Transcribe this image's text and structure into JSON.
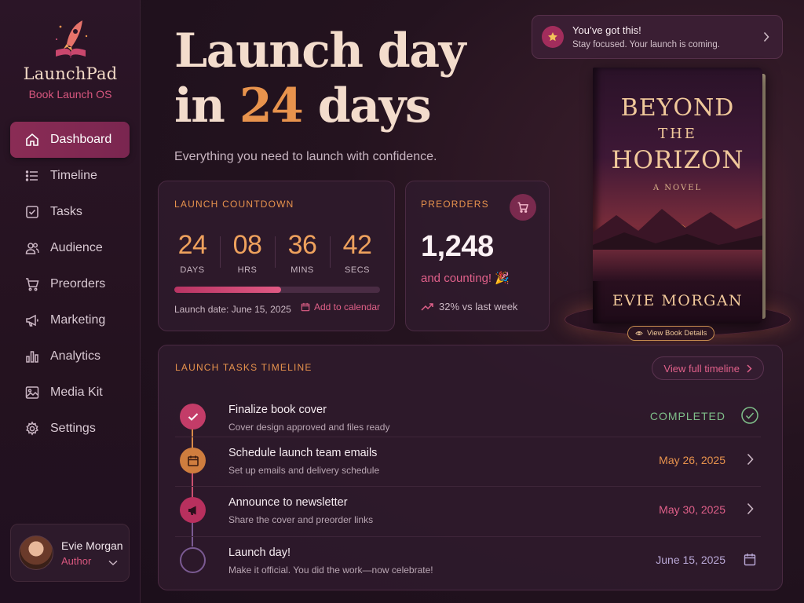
{
  "brand": {
    "name": "LaunchPad",
    "subtitle": "Book Launch OS"
  },
  "sidebar": {
    "items": [
      {
        "label": "Dashboard",
        "icon": "home-icon",
        "active": true
      },
      {
        "label": "Timeline",
        "icon": "list-icon"
      },
      {
        "label": "Tasks",
        "icon": "checkbox-icon"
      },
      {
        "label": "Audience",
        "icon": "users-icon"
      },
      {
        "label": "Preorders",
        "icon": "cart-icon"
      },
      {
        "label": "Marketing",
        "icon": "megaphone-icon"
      },
      {
        "label": "Analytics",
        "icon": "bar-chart-icon"
      },
      {
        "label": "Media Kit",
        "icon": "image-icon"
      },
      {
        "label": "Settings",
        "icon": "gear-icon"
      }
    ]
  },
  "user": {
    "name": "Evie Morgan",
    "role": "Author"
  },
  "hero": {
    "line1": "Launch day",
    "line2_prefix": "in ",
    "days": "24",
    "line2_suffix": " days",
    "subtitle": "Everything you need to launch with confidence."
  },
  "toast": {
    "title": "You’ve got this!",
    "message": "Stay focused. Your launch is coming."
  },
  "countdown": {
    "label": "LAUNCH COUNTDOWN",
    "units": [
      {
        "value": "24",
        "label": "DAYS"
      },
      {
        "value": "08",
        "label": "HRS"
      },
      {
        "value": "36",
        "label": "MINS"
      },
      {
        "value": "42",
        "label": "SECS"
      }
    ],
    "progress": 0.52,
    "launch_date": "Launch date: June 15, 2025",
    "add_calendar": "Add to calendar"
  },
  "preorders": {
    "label": "PREORDERS",
    "count": "1,248",
    "subtext": "and counting! 🎉",
    "trend": "32% vs last week"
  },
  "book": {
    "title_line1": "BEYOND",
    "title_line2": "THE",
    "title_line3": "HORIZON",
    "subtitle": "A NOVEL",
    "author": "EVIE MORGAN",
    "view_details": "View Book Details"
  },
  "timeline": {
    "label": "LAUNCH TASKS TIMELINE",
    "view_full": "View full timeline",
    "tasks": [
      {
        "title": "Finalize book cover",
        "desc": "Cover design approved and files ready",
        "status": "COMPLETED",
        "icon": "check-icon",
        "status_color": "#7fbf8a"
      },
      {
        "title": "Schedule launch team emails",
        "desc": "Set up emails and delivery schedule",
        "status": "May 26, 2025",
        "icon": "calendar-icon",
        "status_color": "#e8934d"
      },
      {
        "title": "Announce to newsletter",
        "desc": "Share the cover and preorder links",
        "status": "May 30, 2025",
        "icon": "megaphone-icon",
        "status_color": "#e0608a"
      },
      {
        "title": "Launch day!",
        "desc": "Make it official. You did the work—now celebrate!",
        "status": "June 15, 2025",
        "icon": "empty-circle-icon",
        "status_color": "#b9a8d6"
      }
    ]
  },
  "colors": {
    "accent_orange": "#e8934d",
    "accent_pink": "#d9577f",
    "active_nav": "#8a2c55",
    "completed_green": "#7fbf8a"
  }
}
